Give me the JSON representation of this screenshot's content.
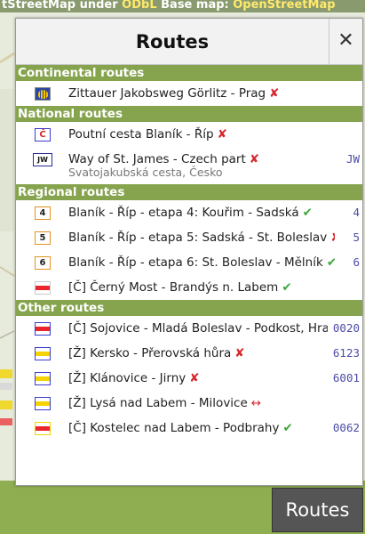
{
  "attribution": {
    "prefix": "tStreetMap under ",
    "odbl": "ODbL",
    "middle": " Base map: ",
    "basemap": "OpenStreetMap"
  },
  "panel": {
    "title": "Routes",
    "close": "✕"
  },
  "sections": {
    "continental": {
      "title": "Continental routes",
      "rows": [
        {
          "label": "Zittauer Jakobsweg Görlitz - Prag",
          "status": "✘",
          "ref": ""
        }
      ]
    },
    "national": {
      "title": "National routes",
      "rows": [
        {
          "sym": "Č",
          "label": "Poutní cesta Blaník - Říp",
          "status": "✘",
          "ref": ""
        },
        {
          "sym": "JW",
          "label": "Way of St. James - Czech part",
          "status": "✘",
          "ref": "JW",
          "sub": "Svatojakubská cesta, Česko"
        }
      ]
    },
    "regional": {
      "title": "Regional routes",
      "rows": [
        {
          "sym": "4",
          "label": "Blaník - Říp - etapa 4: Kouřim - Sadská",
          "status": "✔",
          "ref": "4"
        },
        {
          "sym": "5",
          "label": "Blaník - Říp - etapa 5: Sadská - St. Boleslav",
          "status": "✘",
          "ref": "5"
        },
        {
          "sym": "6",
          "label": "Blaník - Říp - etapa 6: St. Boleslav - Mělník",
          "status": "✔",
          "ref": "6"
        },
        {
          "label": "[Č] Černý Most - Brandýs n. Labem",
          "status": "✔",
          "ref": ""
        }
      ]
    },
    "other": {
      "title": "Other routes",
      "rows": [
        {
          "label": "[Č] Sojovice - Mladá Boleslav - Podkost, Hrad ...",
          "status": "",
          "ref": "0020"
        },
        {
          "label": "[Ž] Kersko - Přerovská hůra",
          "status": "✘",
          "ref": "6123"
        },
        {
          "label": "[Ž] Klánovice - Jirny",
          "status": "✘",
          "ref": "6001"
        },
        {
          "label": "[Ž] Lysá nad Labem - Milovice",
          "status": "↔",
          "ref": ""
        },
        {
          "label": "[Č] Kostelec nad Labem - Podbrahy",
          "status": "✔",
          "ref": "0062"
        }
      ]
    }
  },
  "colors": {
    "section_header": "#86a44e",
    "red_mark": "#e8262b",
    "yellow_mark": "#f4d300",
    "stripe_border_blue": "#3a3ad0"
  },
  "routes_button": "Routes"
}
